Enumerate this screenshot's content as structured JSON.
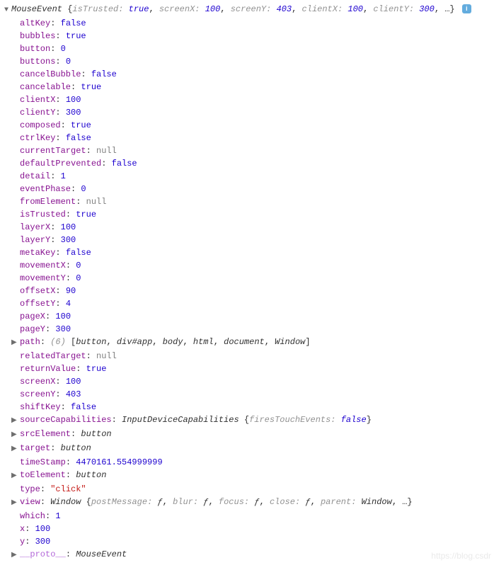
{
  "header": {
    "className": "MouseEvent",
    "openBrace": " {",
    "closeBrace": ", …}",
    "pairs": [
      {
        "k": "isTrusted",
        "sep": ": ",
        "v": "true",
        "cls": "val-bool"
      },
      {
        "k": "screenX",
        "sep": ": ",
        "v": "100",
        "cls": "val-num"
      },
      {
        "k": "screenY",
        "sep": ": ",
        "v": "403",
        "cls": "val-num"
      },
      {
        "k": "clientX",
        "sep": ": ",
        "v": "100",
        "cls": "val-num"
      },
      {
        "k": "clientY",
        "sep": ": ",
        "v": "300",
        "cls": "val-num"
      }
    ],
    "infoGlyph": "i"
  },
  "props": [
    {
      "k": "altKey",
      "v": "false",
      "cls": "val-bool"
    },
    {
      "k": "bubbles",
      "v": "true",
      "cls": "val-bool"
    },
    {
      "k": "button",
      "v": "0",
      "cls": "val-num"
    },
    {
      "k": "buttons",
      "v": "0",
      "cls": "val-num"
    },
    {
      "k": "cancelBubble",
      "v": "false",
      "cls": "val-bool"
    },
    {
      "k": "cancelable",
      "v": "true",
      "cls": "val-bool"
    },
    {
      "k": "clientX",
      "v": "100",
      "cls": "val-num"
    },
    {
      "k": "clientY",
      "v": "300",
      "cls": "val-num"
    },
    {
      "k": "composed",
      "v": "true",
      "cls": "val-bool"
    },
    {
      "k": "ctrlKey",
      "v": "false",
      "cls": "val-bool"
    },
    {
      "k": "currentTarget",
      "v": "null",
      "cls": "val-null"
    },
    {
      "k": "defaultPrevented",
      "v": "false",
      "cls": "val-bool"
    },
    {
      "k": "detail",
      "v": "1",
      "cls": "val-num"
    },
    {
      "k": "eventPhase",
      "v": "0",
      "cls": "val-num"
    },
    {
      "k": "fromElement",
      "v": "null",
      "cls": "val-null"
    },
    {
      "k": "isTrusted",
      "v": "true",
      "cls": "val-bool"
    },
    {
      "k": "layerX",
      "v": "100",
      "cls": "val-num"
    },
    {
      "k": "layerY",
      "v": "300",
      "cls": "val-num"
    },
    {
      "k": "metaKey",
      "v": "false",
      "cls": "val-bool"
    },
    {
      "k": "movementX",
      "v": "0",
      "cls": "val-num"
    },
    {
      "k": "movementY",
      "v": "0",
      "cls": "val-num"
    },
    {
      "k": "offsetX",
      "v": "90",
      "cls": "val-num"
    },
    {
      "k": "offsetY",
      "v": "4",
      "cls": "val-num"
    },
    {
      "k": "pageX",
      "v": "100",
      "cls": "val-num"
    },
    {
      "k": "pageY",
      "v": "300",
      "cls": "val-num"
    },
    {
      "k": "path",
      "exp": true,
      "rawHtml": "<span class='gray'>(6)</span> <span class='bracket'>[</span><span class='cls'>button</span>, <span class='cls'>div#app</span>, <span class='cls'>body</span>, <span class='cls'>html</span>, <span class='cls'>document</span>, <span class='cls'>Window</span><span class='bracket'>]</span>"
    },
    {
      "k": "relatedTarget",
      "v": "null",
      "cls": "val-null"
    },
    {
      "k": "returnValue",
      "v": "true",
      "cls": "val-bool"
    },
    {
      "k": "screenX",
      "v": "100",
      "cls": "val-num"
    },
    {
      "k": "screenY",
      "v": "403",
      "cls": "val-num"
    },
    {
      "k": "shiftKey",
      "v": "false",
      "cls": "val-bool"
    },
    {
      "k": "sourceCapabilities",
      "exp": true,
      "rawHtml": "<span class='cls'>InputDeviceCapabilities</span> <span class='bracket'>{</span><span class='gray'>firesTouchEvents</span><span class='gray'>: </span><span class='val-bool gray'>false</span><span class='bracket'>}</span>"
    },
    {
      "k": "srcElement",
      "exp": true,
      "rawHtml": "<span class='cls'>button</span>"
    },
    {
      "k": "target",
      "exp": true,
      "rawHtml": "<span class='cls'>button</span>"
    },
    {
      "k": "timeStamp",
      "v": "4470161.554999999",
      "cls": "val-num"
    },
    {
      "k": "toElement",
      "exp": true,
      "rawHtml": "<span class='cls'>button</span>"
    },
    {
      "k": "type",
      "v": "\"click\"",
      "cls": "val-str"
    },
    {
      "k": "view",
      "exp": true,
      "rawHtml": "<span class='cls'>Window</span> <span class='bracket'>{</span><span class='gray'>postMessage</span><span class='gray'>: </span><span class='val-sym'>ƒ</span>, <span class='gray'>blur</span><span class='gray'>: </span><span class='val-sym'>ƒ</span>, <span class='gray'>focus</span><span class='gray'>: </span><span class='val-sym'>ƒ</span>, <span class='gray'>close</span><span class='gray'>: </span><span class='val-sym'>ƒ</span>, <span class='gray'>parent</span><span class='gray'>: </span><span class='cls'>Window</span>, …<span class='bracket'>}</span>"
    },
    {
      "k": "which",
      "v": "1",
      "cls": "val-num"
    },
    {
      "k": "x",
      "v": "100",
      "cls": "val-num"
    },
    {
      "k": "y",
      "v": "300",
      "cls": "val-num"
    },
    {
      "k": "__proto__",
      "exp": true,
      "protoKey": true,
      "rawHtml": "<span class='cls'>MouseEvent</span>"
    }
  ],
  "watermark": "https://blog.csdr"
}
